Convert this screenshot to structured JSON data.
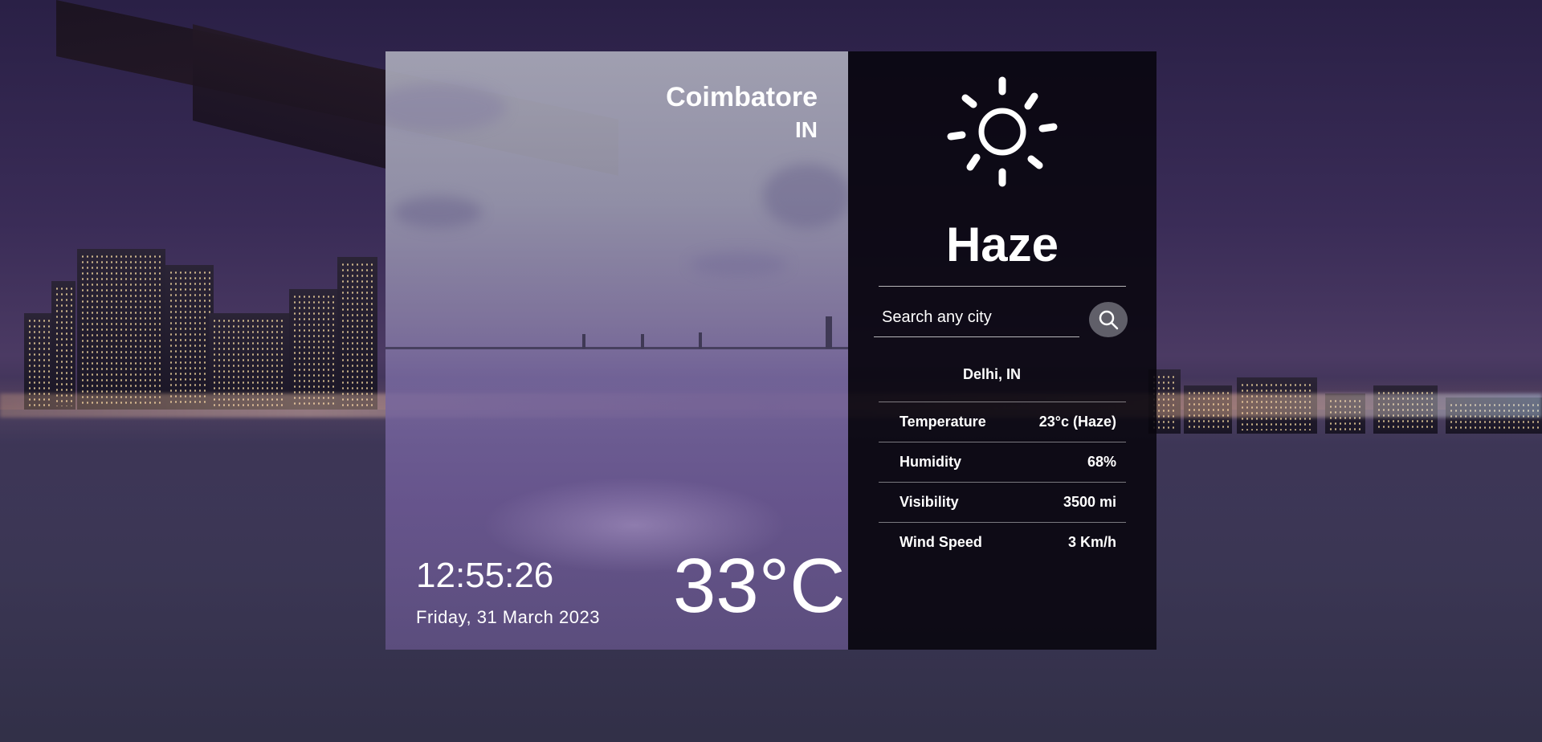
{
  "location": {
    "city": "Coimbatore",
    "country": "IN"
  },
  "time": {
    "clock": "12:55:26",
    "date": "Friday, 31 March 2023"
  },
  "current": {
    "temperature": "33°C",
    "condition": "Haze",
    "icon": "sun-icon"
  },
  "search": {
    "placeholder": "Search any city",
    "button_icon": "search-icon"
  },
  "result": {
    "city": "Delhi, IN",
    "stats": [
      {
        "label": "Temperature",
        "value": "23°c (Haze)"
      },
      {
        "label": "Humidity",
        "value": "68%"
      },
      {
        "label": "Visibility",
        "value": "3500 mi"
      },
      {
        "label": "Wind Speed",
        "value": "3 Km/h"
      }
    ]
  },
  "colors": {
    "right_panel_bg": "#08060e",
    "text": "#ffffff",
    "search_button_bg": "#6e6e78"
  }
}
